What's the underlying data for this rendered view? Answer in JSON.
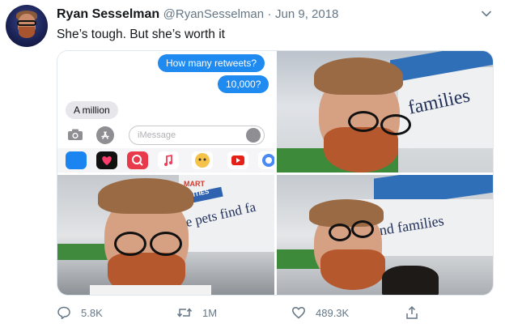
{
  "tweet": {
    "author_name": "Ryan Sesselman",
    "author_handle": "@RyanSesselman",
    "separator": "·",
    "date": "Jun 9, 2018",
    "text": "She’s tough. But she’s worth it"
  },
  "imessage": {
    "sent": [
      "How many retweets?",
      "10,000?"
    ],
    "received": "A million",
    "input_placeholder": "iMessage"
  },
  "photo_signs": {
    "store_text": "families",
    "sign_text_full": "re pets find fa",
    "sign_text_bottom_right": "s find families",
    "badge_text": "ARITIES",
    "badge_prefix": "MART"
  },
  "actions": {
    "replies": "5.8K",
    "retweets": "1M",
    "likes": "489.3K"
  },
  "colors": {
    "text": "#14171a",
    "muted": "#657786",
    "imessage_blue": "#1f8af0"
  }
}
